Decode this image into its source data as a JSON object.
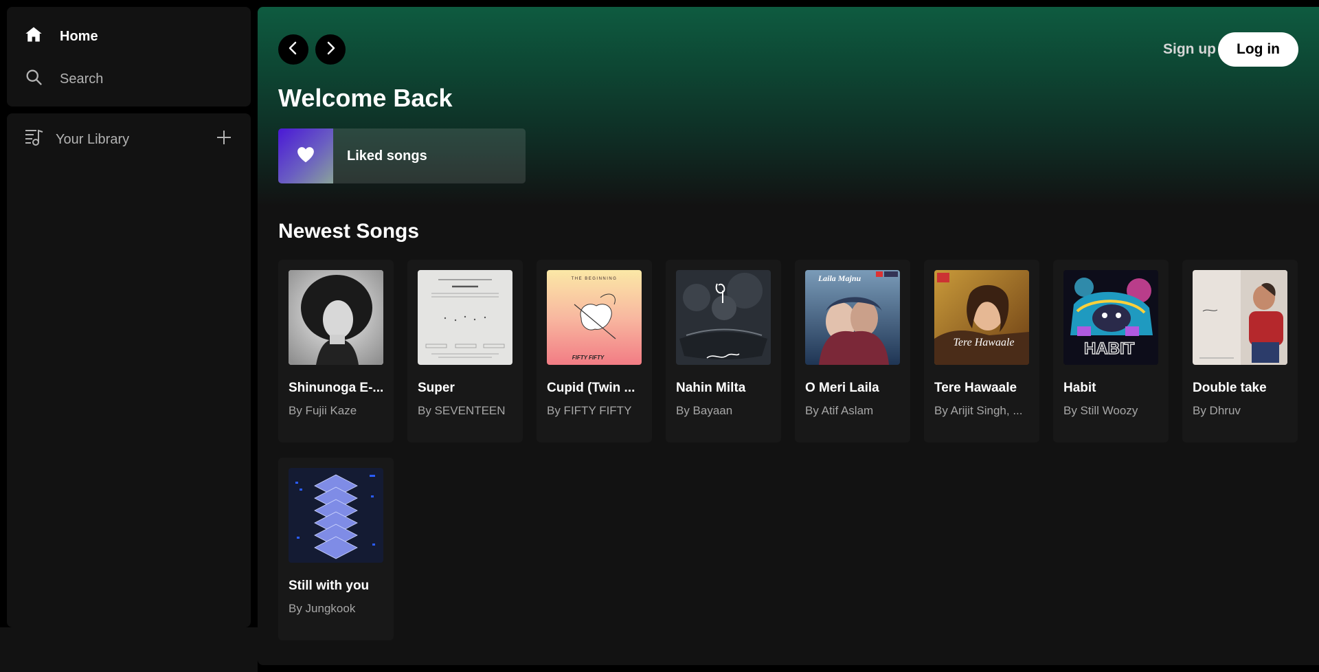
{
  "sidebar": {
    "nav": {
      "home_label": "Home",
      "search_label": "Search"
    },
    "library": {
      "label": "Your Library"
    }
  },
  "header": {
    "signup_label": "Sign up",
    "login_label": "Log in"
  },
  "main": {
    "welcome_title": "Welcome Back",
    "liked_label": "Liked songs",
    "section_title": "Newest Songs",
    "songs": [
      {
        "title": "Shinunoga E-...",
        "artist": "By Fujii Kaze"
      },
      {
        "title": "Super",
        "artist": "By SEVENTEEN"
      },
      {
        "title": "Cupid (Twin ...",
        "artist": "By FIFTY FIFTY"
      },
      {
        "title": "Nahin Milta",
        "artist": "By Bayaan"
      },
      {
        "title": "O Meri Laila",
        "artist": "By Atif Aslam"
      },
      {
        "title": "Tere Hawaale",
        "artist": "By Arijit Singh, ..."
      },
      {
        "title": "Habit",
        "artist": "By Still Woozy"
      },
      {
        "title": "Double take",
        "artist": "By Dhruv"
      },
      {
        "title": "Still with you",
        "artist": "By Jungkook"
      }
    ],
    "album_text": {
      "cupid_top": "THE BEGINNING",
      "cupid_bottom": "FIFTY FIFTY",
      "laila": "Laila Majnu",
      "tere": "Tere Hawaale",
      "habit": "HABIT"
    }
  },
  "colors": {
    "accent_green": "#0e5b40",
    "surface": "#121212",
    "card": "#181818"
  }
}
